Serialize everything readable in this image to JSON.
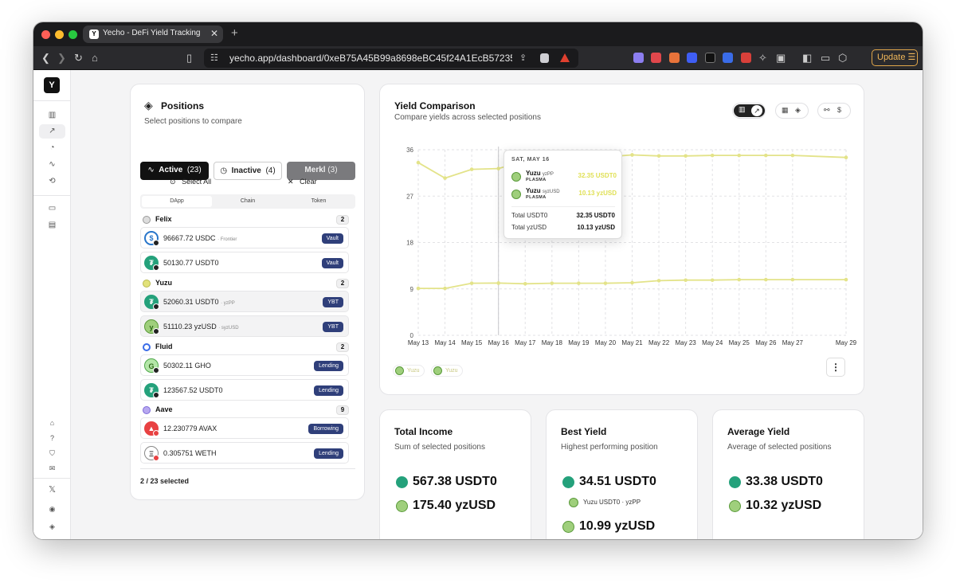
{
  "browser": {
    "tab_title": "Yecho - DeFi Yield Tracking Pl",
    "url": "yecho.app/dashboard/0xeB75A45B99a8698eBC45f24A1EcB57235cC...",
    "update_label": "Update"
  },
  "app": {
    "logo": "Y"
  },
  "positions": {
    "title": "Positions",
    "subtitle": "Select positions to compare",
    "filters": [
      {
        "label": "Active",
        "count": "(23)"
      },
      {
        "label": "Inactive",
        "count": "(4)"
      },
      {
        "label": "Merkl",
        "count": "(3)"
      }
    ],
    "select_all": "Select All",
    "clear": "Clear",
    "group_tabs": [
      "DApp",
      "Chain",
      "Token"
    ],
    "groups": [
      {
        "name": "Felix",
        "count": "2",
        "items": [
          {
            "amount": "96667.72 USDC",
            "tag": "· Frontier",
            "badge": "Vault",
            "icon": "usdc-icon",
            "selected": false
          },
          {
            "amount": "50130.77 USDT0",
            "tag": "",
            "badge": "Vault",
            "icon": "usdt0-icon",
            "selected": false
          }
        ]
      },
      {
        "name": "Yuzu",
        "count": "2",
        "items": [
          {
            "amount": "52060.31 USDT0",
            "tag": "· yzPP",
            "badge": "YBT",
            "icon": "usdt0-icon",
            "selected": true
          },
          {
            "amount": "51110.23 yzUSD",
            "tag": "· syzUSD",
            "badge": "YBT",
            "icon": "yzusd-icon",
            "selected": true
          }
        ]
      },
      {
        "name": "Fluid",
        "count": "2",
        "items": [
          {
            "amount": "50302.11 GHO",
            "tag": "",
            "badge": "Lending",
            "icon": "gho-icon",
            "selected": false
          },
          {
            "amount": "123567.52 USDT0",
            "tag": "",
            "badge": "Lending",
            "icon": "usdt0-icon",
            "selected": false
          }
        ]
      },
      {
        "name": "Aave",
        "count": "9",
        "items": [
          {
            "amount": "12.230779 AVAX",
            "tag": "",
            "badge": "Borrowing",
            "icon": "avax-icon",
            "selected": false
          },
          {
            "amount": "0.305751 WETH",
            "tag": "",
            "badge": "Lending",
            "icon": "weth-icon",
            "selected": false
          }
        ]
      }
    ],
    "selected_summary": "2 / 23 selected"
  },
  "yield": {
    "title": "Yield Comparison",
    "subtitle": "Compare yields across selected positions",
    "tooltip": {
      "date": "SAT, MAY 16",
      "rows": [
        {
          "name": "Yuzu",
          "tag": "yzPP",
          "chain": "PLASMA",
          "value": "32.35 USDT0"
        },
        {
          "name": "Yuzu",
          "tag": "syzUSD",
          "chain": "PLASMA",
          "value": "10.13 yzUSD"
        }
      ],
      "totals": [
        {
          "label": "Total USDT0",
          "value": "32.35 USDT0"
        },
        {
          "label": "Total yzUSD",
          "value": "10.13 yzUSD"
        }
      ]
    },
    "legend": [
      "Yuzu",
      "Yuzu"
    ],
    "more_icon": "more-vertical-icon"
  },
  "chart_data": {
    "type": "line",
    "x": [
      "May 13",
      "May 14",
      "May 15",
      "May 16",
      "May 17",
      "May 18",
      "May 19",
      "May 20",
      "May 21",
      "May 22",
      "May 23",
      "May 24",
      "May 25",
      "May 26",
      "May 27",
      "May 29"
    ],
    "series": [
      {
        "name": "Yuzu",
        "values": [
          33.5,
          30.5,
          32.2,
          32.35,
          33.8,
          34.5,
          34.5,
          34.6,
          35.0,
          34.8,
          34.8,
          34.9,
          34.9,
          34.9,
          34.9,
          34.5
        ]
      },
      {
        "name": "Yuzu",
        "values": [
          9.1,
          9.1,
          10.1,
          10.13,
          10.0,
          10.1,
          10.1,
          10.1,
          10.2,
          10.6,
          10.7,
          10.7,
          10.8,
          10.8,
          10.8,
          10.8
        ]
      }
    ],
    "y_ticks": [
      "0",
      "9",
      "18",
      "27",
      "36"
    ],
    "ylim": [
      0,
      36
    ],
    "color": "#e3e389",
    "grid": true
  },
  "stats": [
    {
      "title": "Total Income",
      "subtitle": "Sum of selected positions",
      "values": [
        "567.38 USDT0",
        "175.40 yzUSD"
      ]
    },
    {
      "title": "Best Yield",
      "subtitle": "Highest performing position",
      "values": [
        "34.51 USDT0",
        "10.99 yzUSD"
      ],
      "source": "Yuzu USDT0 · yzPP"
    },
    {
      "title": "Average Yield",
      "subtitle": "Average of selected positions",
      "values": [
        "33.38 USDT0",
        "10.32 yzUSD"
      ]
    }
  ]
}
